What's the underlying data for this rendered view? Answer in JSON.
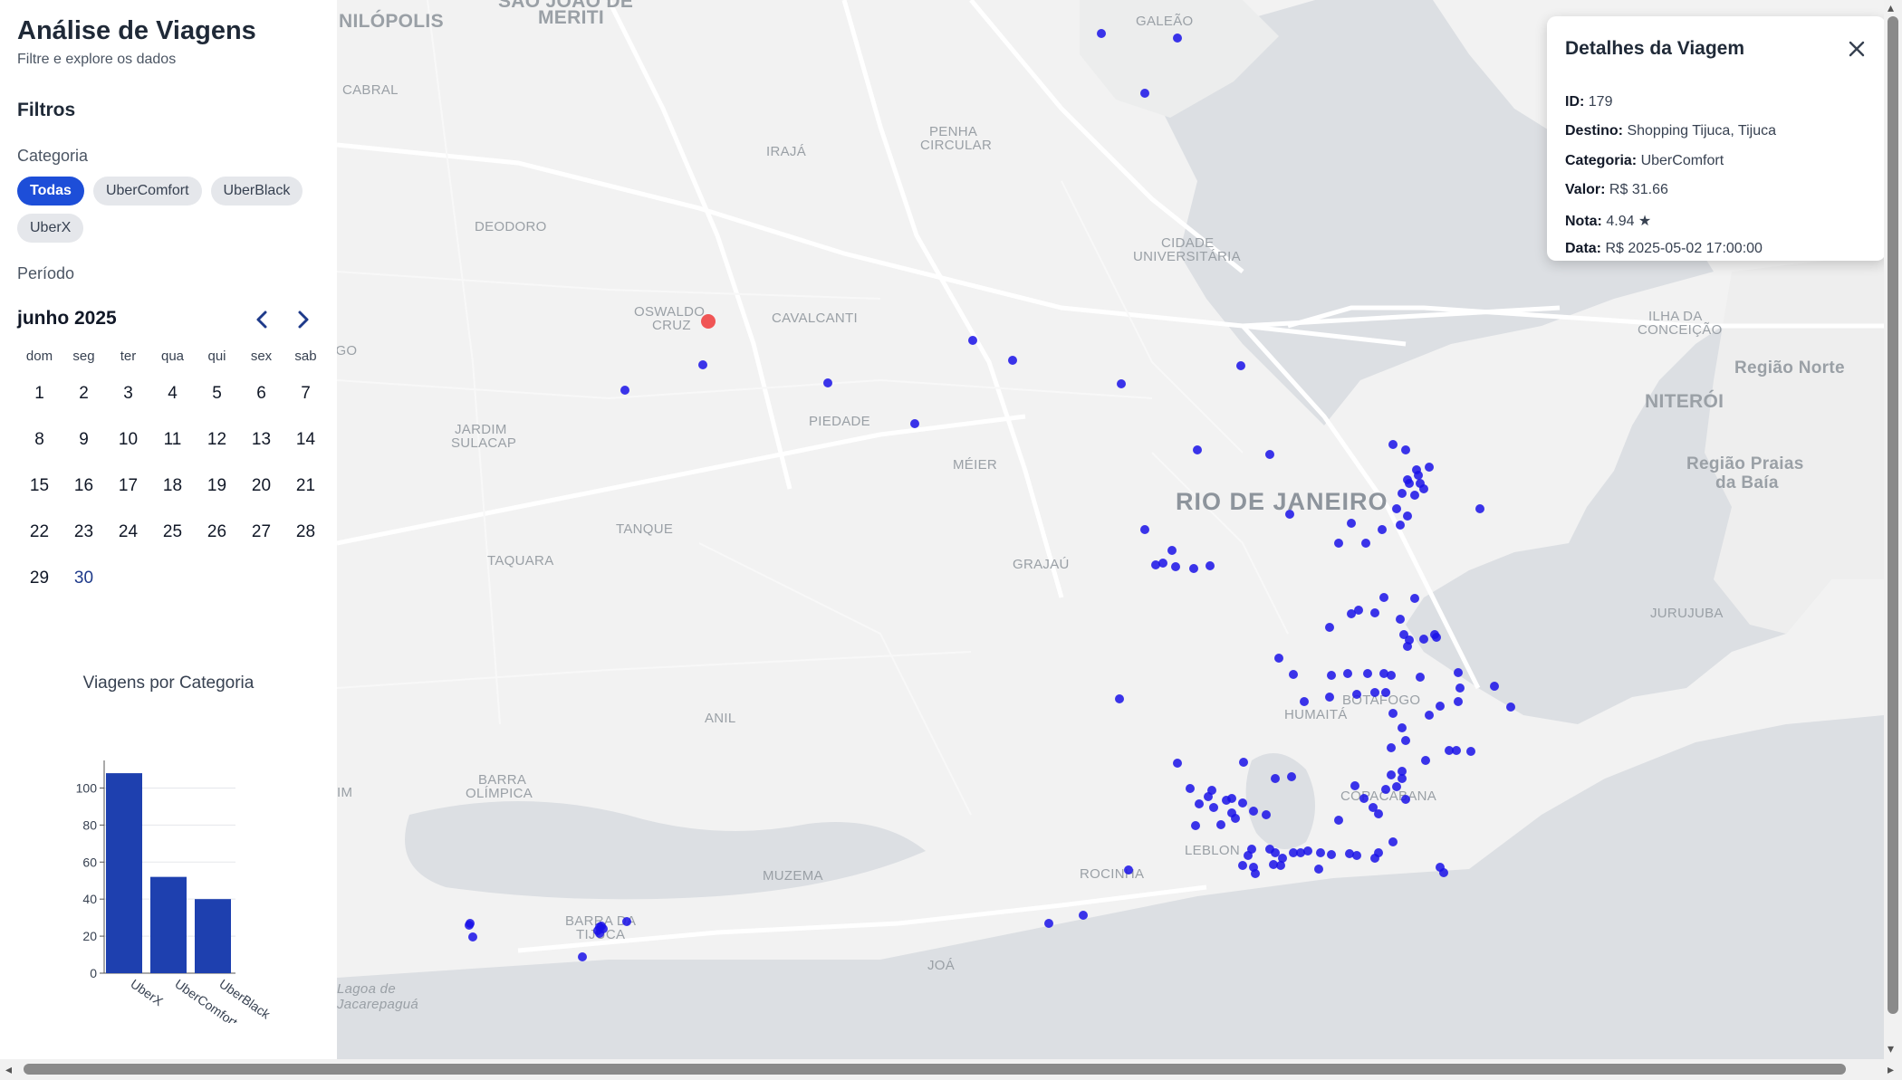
{
  "sidebar": {
    "title": "Análise de Viagens",
    "subtitle": "Filtre e explore os dados",
    "filters_heading": "Filtros",
    "category_label": "Categoria",
    "categories": [
      "Todas",
      "UberComfort",
      "UberBlack",
      "UberX"
    ],
    "active_category": "Todas",
    "period_label": "Período",
    "calendar": {
      "month_label": "junho 2025",
      "weekdays": [
        "dom",
        "seg",
        "ter",
        "qua",
        "qui",
        "sex",
        "sab"
      ],
      "days": [
        "1",
        "2",
        "3",
        "4",
        "5",
        "6",
        "7",
        "8",
        "9",
        "10",
        "11",
        "12",
        "13",
        "14",
        "15",
        "16",
        "17",
        "18",
        "19",
        "20",
        "21",
        "22",
        "23",
        "24",
        "25",
        "26",
        "27",
        "28",
        "29",
        "30"
      ],
      "highlighted_day": "30"
    },
    "chart_title": "Viagens por Categoria"
  },
  "chart_data": {
    "type": "bar",
    "title": "Viagens por Categoria",
    "categories": [
      "UberX",
      "UberComfort",
      "UberBlack"
    ],
    "values": [
      108,
      52,
      40
    ],
    "yticks": [
      "0",
      "20",
      "40",
      "60",
      "80",
      "100"
    ],
    "ylim": [
      0,
      110
    ],
    "bar_color": "#1e40af",
    "grid": true
  },
  "map": {
    "labels": {
      "nilopolis": "NILÓPOLIS",
      "sao_joao": "SÃO JOÃO DE",
      "meriti": "MERITI",
      "galeao": "GALEÃO",
      "cabral": "CABRAL",
      "iraja": "IRAJÁ",
      "penha": "PENHA",
      "circular": "CIRCULAR",
      "deodoro": "DEODORO",
      "cidade": "CIDADE",
      "universitaria": "UNIVERSITÁRIA",
      "oswaldo": "OSWALDO",
      "cruz": "CRUZ",
      "cavalcanti": "CAVALCANTI",
      "ilha_da": "ILHA DA",
      "conceicao": "CONCEIÇÃO",
      "regiao_norte": "Região Norte",
      "niteroi": "NITERÓI",
      "go": "IGO",
      "jardim": "JARDIM",
      "sulacap": "SULACAP",
      "piedade": "PIEDADE",
      "meier": "MÉIER",
      "rio": "RIO DE JANEIRO",
      "regiao_praias": "Região Praias",
      "da_baia": "da Baía",
      "tanque": "TANQUE",
      "taquara": "TAQUARA",
      "grajau": "GRAJAÚ",
      "jurujuba": "JURUJUBA",
      "humaita": "HUMAITÁ",
      "botafogo": "BOTAFOGO",
      "anil": "ANIL",
      "barra": "BARRA",
      "olimpica": "OLÍMPICA",
      "im": "IM",
      "copacabana": "COPACABANA",
      "leblon": "LEBLON",
      "muzema": "MUZEMA",
      "rocinha": "ROCINHA",
      "barra_da": "BARRA DA",
      "tijuca": "TIJUCA",
      "joa": "JOÁ",
      "lagoa": "Lagoa de",
      "jacarepagua": "Jacarepaguá"
    },
    "point_color": "#1a12e8",
    "selected_color": "#ef4444"
  },
  "popup": {
    "title": "Detalhes da Viagem",
    "id_label": "ID:",
    "id_value": "179",
    "destino_label": "Destino:",
    "destino_value": "Shopping Tijuca, Tijuca",
    "categoria_label": "Categoria:",
    "categoria_value": "UberComfort",
    "valor_label": "Valor:",
    "valor_value": "R$ 31.66",
    "nota_label": "Nota:",
    "nota_value": "4.94 ★",
    "data_label": "Data:",
    "data_value": "R$ 2025-05-02 17:00:00"
  }
}
